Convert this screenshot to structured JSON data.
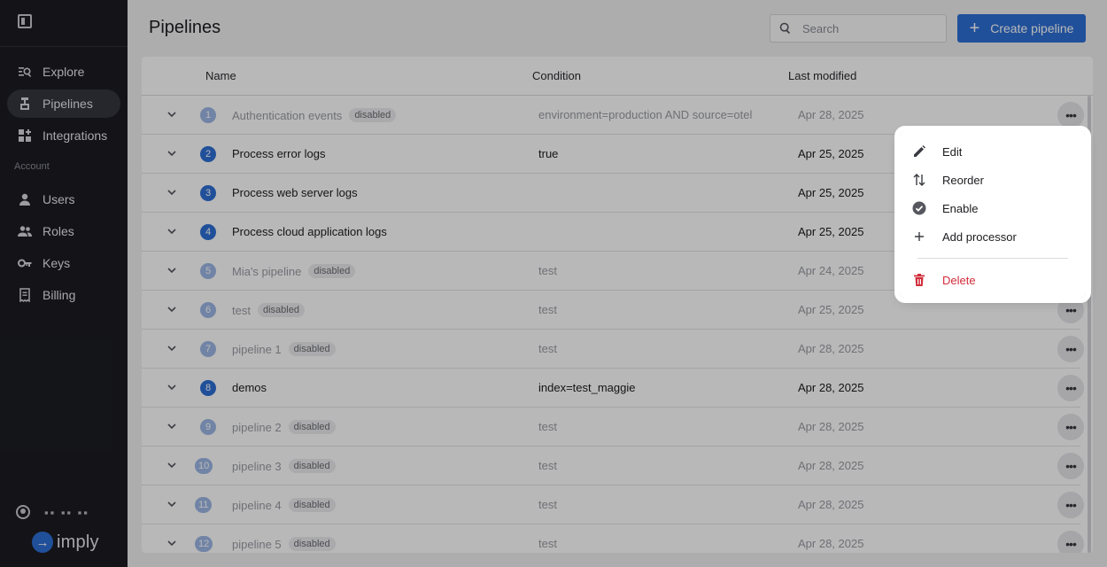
{
  "sidebar": {
    "nav_main": [
      {
        "label": "Explore",
        "icon": "explore-icon"
      },
      {
        "label": "Pipelines",
        "icon": "pipelines-icon",
        "active": true
      },
      {
        "label": "Integrations",
        "icon": "integrations-icon"
      }
    ],
    "section_label": "Account",
    "nav_account": [
      {
        "label": "Users",
        "icon": "user-icon"
      },
      {
        "label": "Roles",
        "icon": "roles-icon"
      },
      {
        "label": "Keys",
        "icon": "key-icon"
      },
      {
        "label": "Billing",
        "icon": "billing-icon"
      }
    ],
    "user_name": "▪▪ ▪▪ ▪▪",
    "logo_text": "imply"
  },
  "header": {
    "title": "Pipelines",
    "search_placeholder": "Search",
    "create_label": "Create pipeline"
  },
  "table": {
    "columns": [
      "Name",
      "Condition",
      "Last modified"
    ],
    "rows": [
      {
        "num": "1",
        "name": "Authentication events",
        "disabled": true,
        "badge": "disabled",
        "condition": "environment=production AND source=otel",
        "date": "Apr 28, 2025"
      },
      {
        "num": "2",
        "name": "Process error logs",
        "disabled": false,
        "badge": "",
        "condition": "true",
        "date": "Apr 25, 2025"
      },
      {
        "num": "3",
        "name": "Process web server logs",
        "disabled": false,
        "badge": "",
        "condition": "",
        "date": "Apr 25, 2025"
      },
      {
        "num": "4",
        "name": "Process cloud application logs",
        "disabled": false,
        "badge": "",
        "condition": "",
        "date": "Apr 25, 2025"
      },
      {
        "num": "5",
        "name": "Mia's pipeline",
        "disabled": true,
        "badge": "disabled",
        "condition": "test",
        "date": "Apr 24, 2025"
      },
      {
        "num": "6",
        "name": "test",
        "disabled": true,
        "badge": "disabled",
        "condition": "test",
        "date": "Apr 25, 2025"
      },
      {
        "num": "7",
        "name": "pipeline 1",
        "disabled": true,
        "badge": "disabled",
        "condition": "test",
        "date": "Apr 28, 2025"
      },
      {
        "num": "8",
        "name": "demos",
        "disabled": false,
        "badge": "",
        "condition": "index=test_maggie",
        "date": "Apr 28, 2025"
      },
      {
        "num": "9",
        "name": "pipeline 2",
        "disabled": true,
        "badge": "disabled",
        "condition": "test",
        "date": "Apr 28, 2025"
      },
      {
        "num": "10",
        "name": "pipeline 3",
        "disabled": true,
        "badge": "disabled",
        "condition": "test",
        "date": "Apr 28, 2025"
      },
      {
        "num": "11",
        "name": "pipeline 4",
        "disabled": true,
        "badge": "disabled",
        "condition": "test",
        "date": "Apr 28, 2025"
      },
      {
        "num": "12",
        "name": "pipeline 5",
        "disabled": true,
        "badge": "disabled",
        "condition": "test",
        "date": "Apr 28, 2025"
      }
    ]
  },
  "context_menu": {
    "items": [
      {
        "label": "Edit",
        "icon": "pencil-icon"
      },
      {
        "label": "Reorder",
        "icon": "reorder-icon"
      },
      {
        "label": "Enable",
        "icon": "check-circle-icon"
      },
      {
        "label": "Add processor",
        "icon": "plus-icon"
      }
    ],
    "delete_label": "Delete",
    "delete_icon": "trash-icon"
  },
  "colors": {
    "accent": "#2f6fd6",
    "sidebar_bg": "#1c1d22",
    "danger": "#d12c3a"
  }
}
